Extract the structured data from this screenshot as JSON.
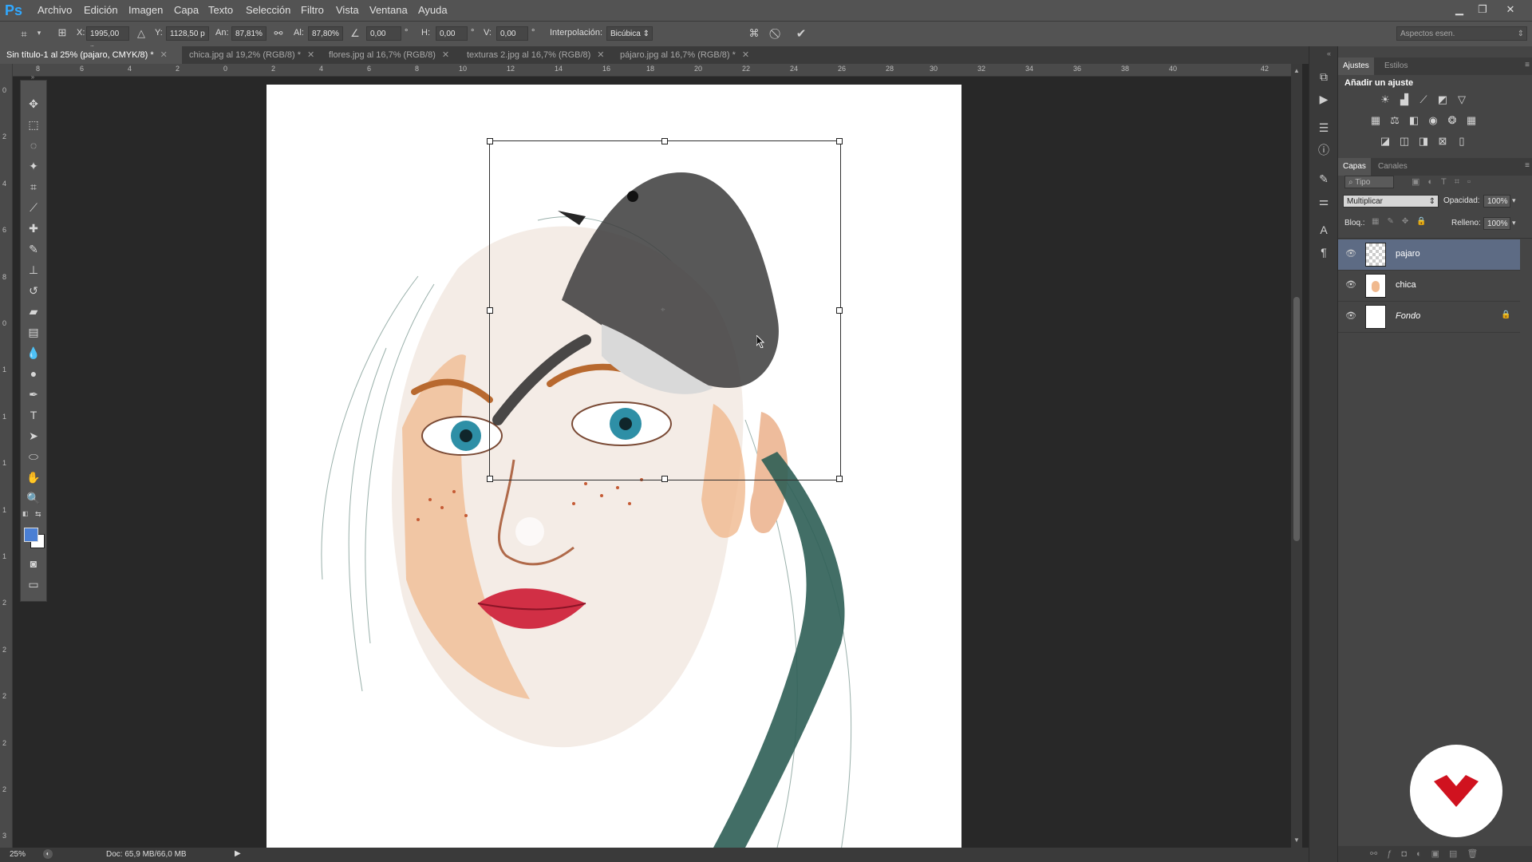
{
  "app": {
    "logo": "Ps",
    "menu": [
      "Archivo",
      "Edición",
      "Imagen",
      "Capa",
      "Texto",
      "Selección",
      "Filtro",
      "Vista",
      "Ventana",
      "Ayuda"
    ],
    "window_buttons": [
      "minimize-icon",
      "restore-icon",
      "close-icon"
    ]
  },
  "options": {
    "x_label": "X:",
    "x_value": "1995,00 p",
    "y_label": "Y:",
    "y_value": "1128,50 p",
    "w_label": "An:",
    "w_value": "87,81%",
    "h_label": "Al:",
    "h_value": "87,80%",
    "angle_value": "0,00",
    "deg": "°",
    "hskew_label": "H:",
    "hskew_value": "0,00",
    "vskew_label": "V:",
    "vskew_value": "0,00",
    "interp_label": "Interpolación:",
    "interp_value": "Bicúbica",
    "workspace": "Aspectos esen."
  },
  "tabs": [
    {
      "label": "Sin título-1 al 25% (pajaro, CMYK/8) *",
      "active": true
    },
    {
      "label": "chica.jpg al 19,2% (RGB/8) *",
      "active": false
    },
    {
      "label": "flores.jpg al 16,7% (RGB/8)",
      "active": false
    },
    {
      "label": "texturas 2.jpg al 16,7% (RGB/8)",
      "active": false
    },
    {
      "label": "pájaro.jpg al 16,7% (RGB/8) *",
      "active": false
    }
  ],
  "ruler": {
    "h": [
      "8",
      "6",
      "4",
      "2",
      "0",
      "2",
      "4",
      "6",
      "8",
      "10",
      "12",
      "14",
      "16",
      "18",
      "20",
      "22",
      "24",
      "26",
      "28",
      "30",
      "32",
      "34",
      "36",
      "38",
      "40",
      "42"
    ],
    "v": [
      "0",
      "2",
      "4",
      "6",
      "8",
      "0",
      "1",
      "1",
      "1",
      "1",
      "1",
      "2",
      "2",
      "2",
      "2",
      "2",
      "3"
    ]
  },
  "status": {
    "zoom": "25%",
    "doc": "Doc: 65,9 MB/66,0 MB"
  },
  "panels": {
    "adjust_tabs": [
      "Ajustes",
      "Estilos"
    ],
    "adjust_title": "Añadir un ajuste",
    "layers_tabs": [
      "Capas",
      "Canales"
    ],
    "kind_filter": "Tipo",
    "blend_mode": "Multiplicar",
    "opacity_label": "Opacidad:",
    "opacity_value": "100%",
    "lock_label": "Bloq.:",
    "fill_label": "Relleno:",
    "fill_value": "100%",
    "layers": [
      {
        "name": "pajaro",
        "selected": true
      },
      {
        "name": "chica",
        "selected": false
      },
      {
        "name": "Fondo",
        "selected": false,
        "locked": true
      }
    ]
  },
  "colors": {
    "foreground": "#4a7fd4",
    "background": "#ffffff",
    "selection_highlight": "#5d6b84",
    "brand_red": "#d0121f"
  }
}
